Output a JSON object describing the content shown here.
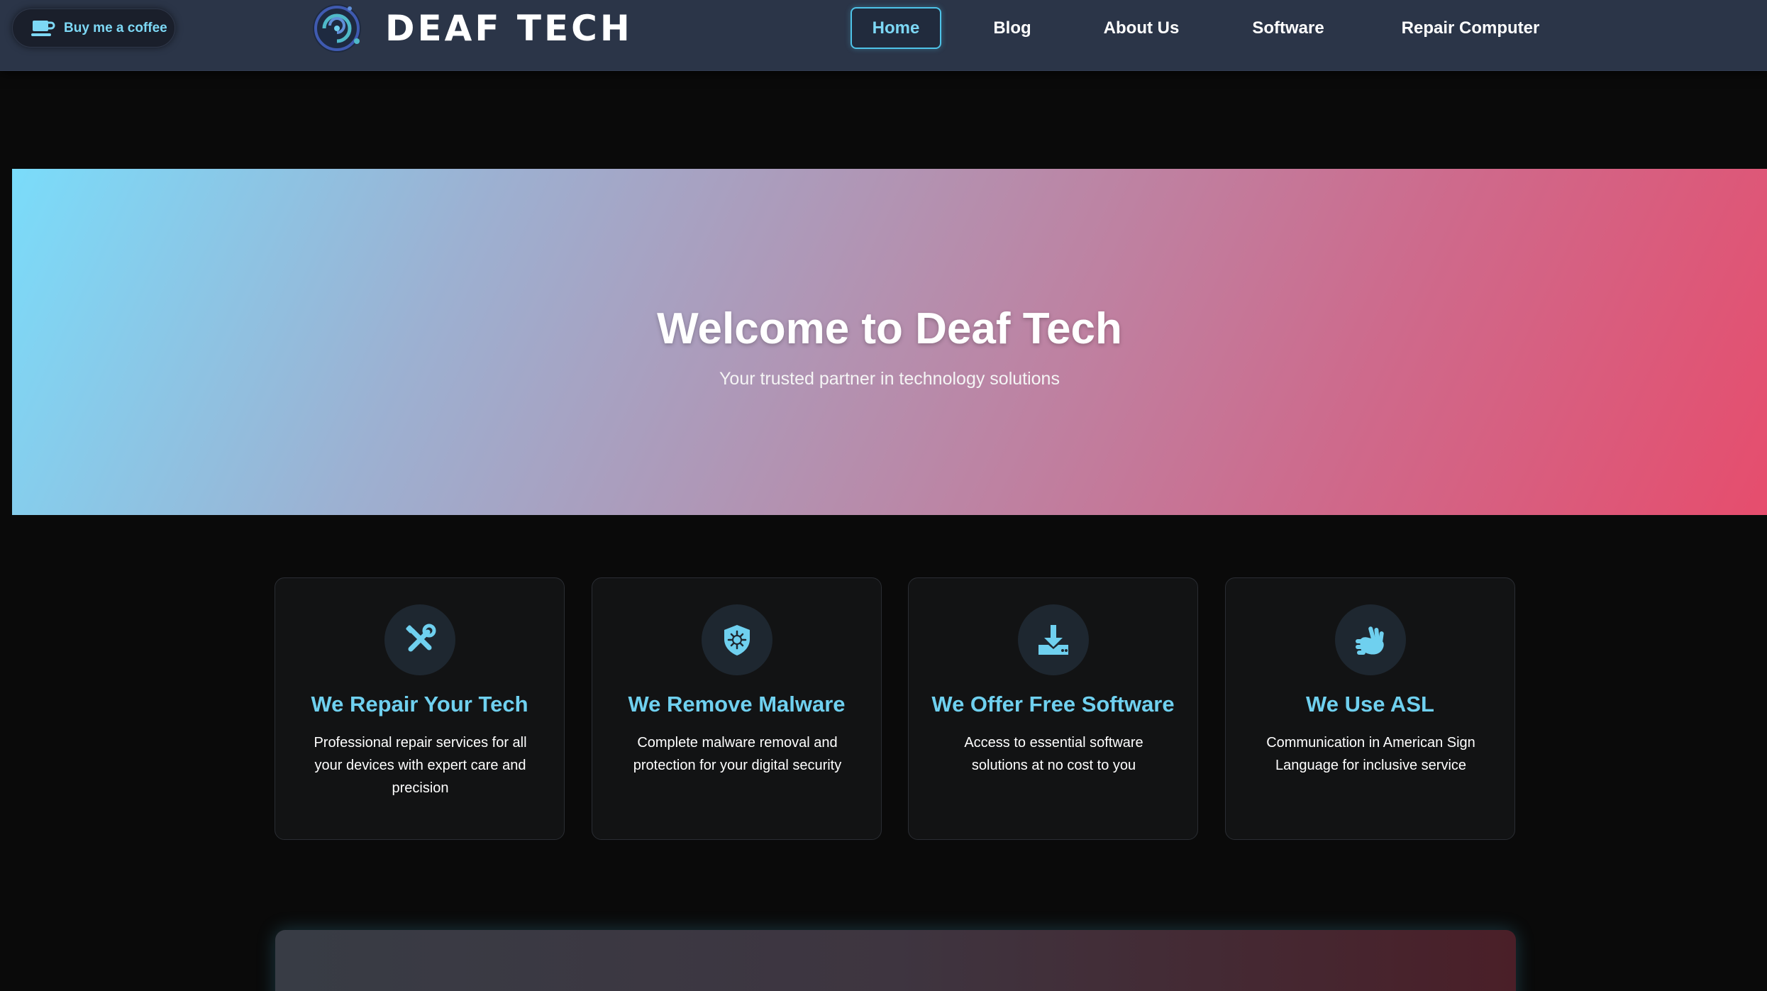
{
  "header": {
    "coffee_label": "Buy me a coffee",
    "brand": "DEAF TECH",
    "nav": [
      {
        "label": "Home",
        "active": true
      },
      {
        "label": "Blog",
        "active": false
      },
      {
        "label": "About Us",
        "active": false
      },
      {
        "label": "Software",
        "active": false
      },
      {
        "label": "Repair Computer",
        "active": false
      }
    ]
  },
  "hero": {
    "title": "Welcome to Deaf Tech",
    "subtitle": "Your trusted partner in technology solutions"
  },
  "features": [
    {
      "icon": "tools-icon",
      "title": "We Repair Your Tech",
      "text": "Professional repair services for all your devices with expert care and precision"
    },
    {
      "icon": "shield-virus-icon",
      "title": "We Remove Malware",
      "text": "Complete malware removal and protection for your digital security"
    },
    {
      "icon": "download-icon",
      "title": "We Offer Free Software",
      "text": "Access to essential software solutions at no cost to you"
    },
    {
      "icon": "sign-language-icon",
      "title": "We Use ASL",
      "text": "Communication in American Sign Language for inclusive service"
    }
  ],
  "colors": {
    "accent": "#6fd0ef",
    "header_bg": "#2b3548",
    "page_bg": "#0a0a0a",
    "card_bg": "#121314",
    "hero_gradient_start": "#7adcfa",
    "hero_gradient_end": "#e64d6d"
  }
}
